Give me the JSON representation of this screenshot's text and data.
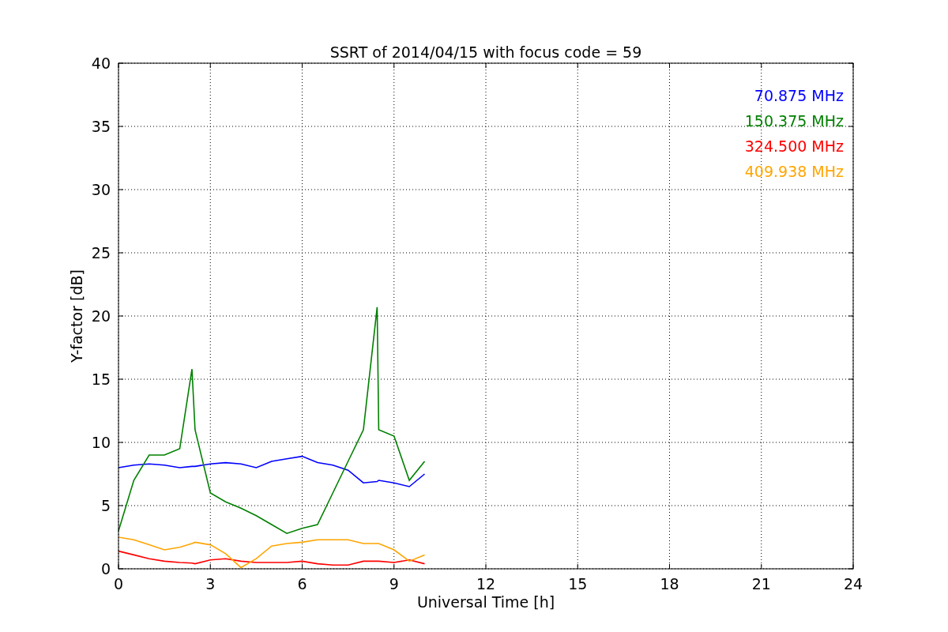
{
  "chart_data": {
    "type": "line",
    "title": "SSRT of 2014/04/15 with focus code = 59",
    "xlabel": "Universal Time [h]",
    "ylabel": "Y-factor [dB]",
    "x": [
      0,
      0.5,
      1,
      1.5,
      2,
      2.4,
      2.5,
      3,
      3.5,
      4,
      4.5,
      5,
      5.5,
      6,
      6.5,
      7,
      7.5,
      8,
      8.45,
      8.5,
      9,
      9.5,
      10
    ],
    "series": [
      {
        "name": "70.875 MHz",
        "color": "#0000ff",
        "values": [
          8.0,
          8.2,
          8.3,
          8.2,
          8.0,
          8.1,
          8.1,
          8.3,
          8.4,
          8.3,
          8.0,
          8.5,
          8.7,
          8.9,
          8.4,
          8.2,
          7.8,
          6.8,
          6.9,
          7.0,
          6.8,
          6.5,
          7.5
        ]
      },
      {
        "name": "150.375 MHz",
        "color": "#008000",
        "values": [
          3.0,
          7.0,
          9.0,
          9.0,
          9.5,
          15.8,
          11.0,
          6.0,
          5.3,
          4.8,
          4.2,
          3.5,
          2.8,
          3.2,
          3.5,
          6.0,
          8.5,
          11.0,
          20.7,
          11.0,
          10.5,
          7.0,
          8.5
        ]
      },
      {
        "name": "324.500 MHz",
        "color": "#ff0000",
        "values": [
          1.4,
          1.1,
          0.8,
          0.6,
          0.5,
          0.45,
          0.4,
          0.7,
          0.8,
          0.6,
          0.5,
          0.5,
          0.5,
          0.6,
          0.4,
          0.3,
          0.3,
          0.6,
          0.6,
          0.6,
          0.5,
          0.7,
          0.4
        ]
      },
      {
        "name": "409.938 MHz",
        "color": "#ffa500",
        "values": [
          2.5,
          2.3,
          1.9,
          1.5,
          1.7,
          2.0,
          2.1,
          1.9,
          1.2,
          0.1,
          0.8,
          1.8,
          2.0,
          2.1,
          2.3,
          2.3,
          2.3,
          2.0,
          2.0,
          2.0,
          1.5,
          0.6,
          1.1
        ]
      }
    ],
    "grid": true,
    "xlim": [
      0,
      24
    ],
    "ylim": [
      0,
      40
    ],
    "xticks": [
      0,
      3,
      6,
      9,
      12,
      15,
      18,
      21,
      24
    ],
    "yticks": [
      0,
      5,
      10,
      15,
      20,
      25,
      30,
      35,
      40
    ]
  }
}
